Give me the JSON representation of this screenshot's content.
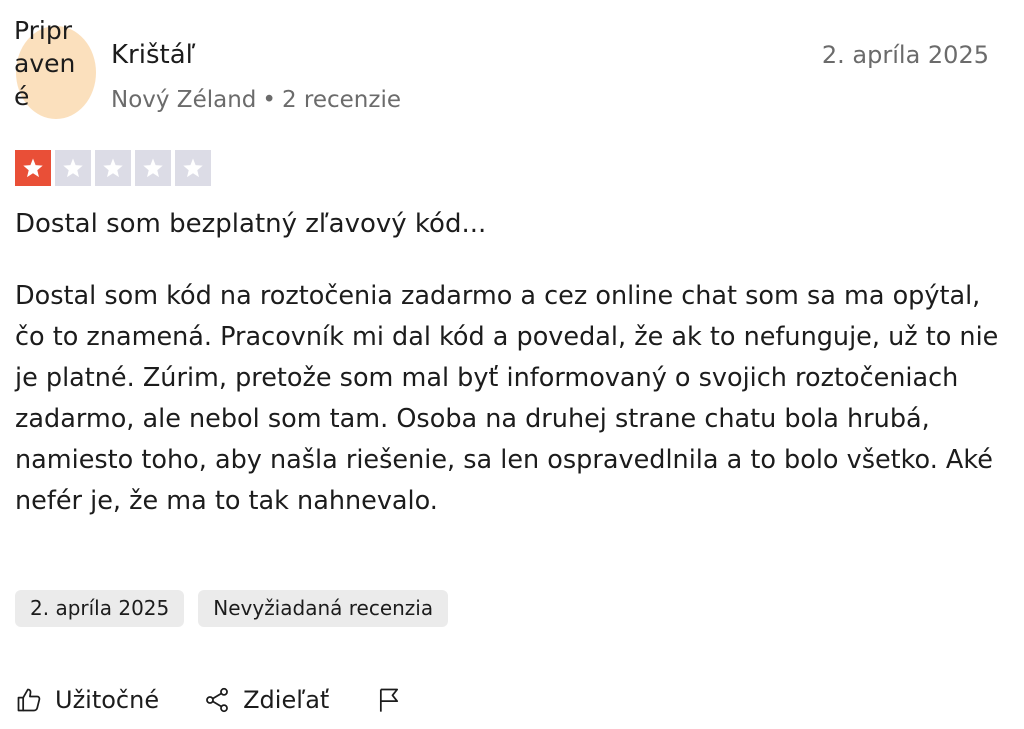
{
  "reviewer": {
    "avatar_text": "Pripravené",
    "name": "Krištáľ",
    "country": "Nový Zéland",
    "separator": "•",
    "review_count": "2 recenzie",
    "avatar_color": "#fbe0bd"
  },
  "review": {
    "date": "2. apríla 2025",
    "rating": 1,
    "max_rating": 5,
    "star_filled_color": "#e94f37",
    "star_empty_color": "#dcdce6",
    "title": "Dostal som bezplatný zľavový kód...",
    "body": "Dostal som kód na roztočenia zadarmo a cez online chat som sa ma opýtal, čo to znamená. Pracovník mi dal kód a povedal, že ak to nefunguje, už to nie je platné. Zúrim, pretože som mal byť informovaný o svojich roztočeniach zadarmo, ale nebol som tam. Osoba na druhej strane chatu bola hrubá, namiesto toho, aby našla riešenie, sa len ospravedlnila a to bolo všetko. Aké nefér je, že ma to tak nahnevalo."
  },
  "tags": {
    "date": "2. apríla 2025",
    "type": "Nevyžiadaná recenzia"
  },
  "actions": {
    "useful_label": "Užitočné",
    "useful_icon": "thumbs-up-icon",
    "share_label": "Zdieľať",
    "share_icon": "share-icon",
    "flag_icon": "flag-icon"
  }
}
